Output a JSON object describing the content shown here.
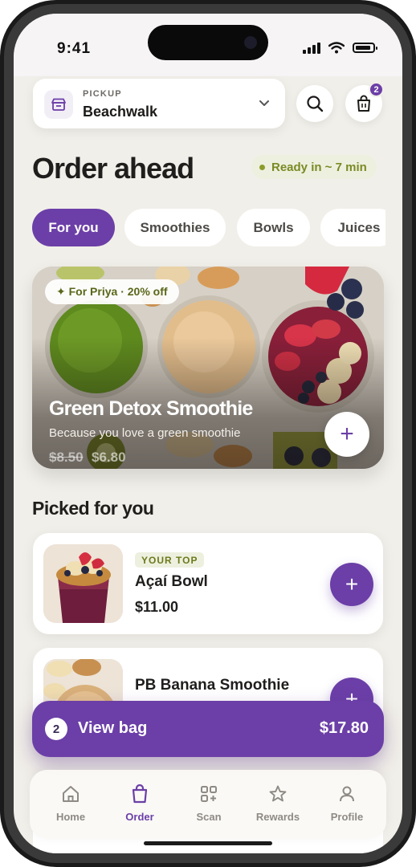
{
  "status_bar": {
    "time": "9:41"
  },
  "header": {
    "pickup_label": "PICKUP",
    "store_name": "Beachwalk",
    "bag_count": "2"
  },
  "page": {
    "title": "Order ahead",
    "ready_text": "Ready in ~ 7 min"
  },
  "tabs": [
    {
      "label": "For you",
      "active": true
    },
    {
      "label": "Smoothies",
      "active": false
    },
    {
      "label": "Bowls",
      "active": false
    },
    {
      "label": "Juices",
      "active": false
    }
  ],
  "hero": {
    "promo": "✦ For Priya · 20% off",
    "name": "Green Detox Smoothie",
    "subtitle": "Because you love a green smoothie",
    "old_price": "$8.50",
    "new_price": "$6.80",
    "add_symbol": "+"
  },
  "section_title": "Picked for you",
  "products": [
    {
      "tag": "YOUR TOP",
      "name": "Açaí Bowl",
      "price": "$11.00",
      "add_symbol": "+"
    },
    {
      "tag": "",
      "name": "PB Banana Smoothie",
      "price": "",
      "add_symbol": "+"
    }
  ],
  "view_bag": {
    "count": "2",
    "label": "View bag",
    "total": "$17.80"
  },
  "bottom_nav": [
    {
      "label": "Home",
      "icon": "home-icon",
      "active": false
    },
    {
      "label": "Order",
      "icon": "bag-icon",
      "active": true
    },
    {
      "label": "Scan",
      "icon": "scan-icon",
      "active": false
    },
    {
      "label": "Rewards",
      "icon": "star-icon",
      "active": false
    },
    {
      "label": "Profile",
      "icon": "person-icon",
      "active": false
    }
  ],
  "colors": {
    "brand_purple": "#6b3fa7",
    "accent_green": "#7a8a24",
    "background": "#f1efe9"
  }
}
